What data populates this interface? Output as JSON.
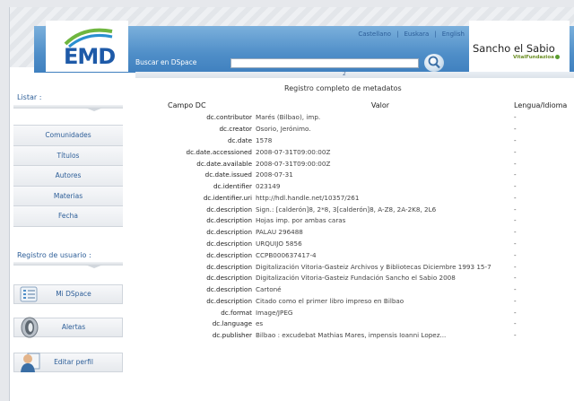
{
  "header": {
    "logo_text": "EMD",
    "languages": [
      "Castellano",
      "Euskara",
      "English"
    ],
    "language_separator": "|",
    "search_label": "Buscar en DSpace",
    "search_value": "",
    "handle_number": "2",
    "sancho_title": "Sancho el Sabio",
    "sancho_subtitle": "VitalFundazioa"
  },
  "sidebar": {
    "browse_heading": "Listar :",
    "browse_items": [
      "Comunidades",
      "Títulos",
      "Autores",
      "Materias",
      "Fecha"
    ],
    "user_heading": "Registro de usuario :",
    "user_items": [
      {
        "label": "Mi DSpace",
        "icon": "list-icon"
      },
      {
        "label": "Alertas",
        "icon": "bell-icon"
      },
      {
        "label": "Editar perfil",
        "icon": "user-profile-icon"
      }
    ]
  },
  "main": {
    "title": "Registro completo de metadatos",
    "columns": [
      "Campo DC",
      "Valor",
      "Lengua/Idioma"
    ],
    "rows": [
      {
        "field": "dc.contributor",
        "value": "Marés (Bilbao), imp.",
        "lang": "-"
      },
      {
        "field": "dc.creator",
        "value": "Osorio, Jerónimo.",
        "lang": "-"
      },
      {
        "field": "dc.date",
        "value": "1578",
        "lang": "-"
      },
      {
        "field": "dc.date.accessioned",
        "value": "2008-07-31T09:00:00Z",
        "lang": "-"
      },
      {
        "field": "dc.date.available",
        "value": "2008-07-31T09:00:00Z",
        "lang": "-"
      },
      {
        "field": "dc.date.issued",
        "value": "2008-07-31",
        "lang": "-"
      },
      {
        "field": "dc.identifier",
        "value": "023149",
        "lang": "-"
      },
      {
        "field": "dc.identifier.uri",
        "value": "http://hdl.handle.net/10357/261",
        "lang": "-"
      },
      {
        "field": "dc.description",
        "value": "Sign.: [calderón]8, 2*8, 3[calderón]8, A-Z8, 2A-2K8, 2L6",
        "lang": "-"
      },
      {
        "field": "dc.description",
        "value": "Hojas imp. por ambas caras",
        "lang": "-"
      },
      {
        "field": "dc.description",
        "value": "PALAU 296488",
        "lang": "-"
      },
      {
        "field": "dc.description",
        "value": "URQUIJO 5856",
        "lang": "-"
      },
      {
        "field": "dc.description",
        "value": "CCPB000637417-4",
        "lang": "-"
      },
      {
        "field": "dc.description",
        "value": "Digitalización Vitoria-Gasteiz Archivos y Bibliotecas Diciembre 1993 15-7",
        "lang": "-"
      },
      {
        "field": "dc.description",
        "value": "Digitalización Vitoria-Gasteiz Fundación Sancho el Sabio 2008",
        "lang": "-"
      },
      {
        "field": "dc.description",
        "value": "Cartoné",
        "lang": "-"
      },
      {
        "field": "dc.description",
        "value": "Citado como el primer libro impreso en Bilbao",
        "lang": "-"
      },
      {
        "field": "dc.format",
        "value": "Image/JPEG",
        "lang": "-"
      },
      {
        "field": "dc.language",
        "value": "es",
        "lang": "-"
      },
      {
        "field": "dc.publisher",
        "value": "Bilbao : excudebat Mathias Mares, impensis Ioanni Lopez...",
        "lang": "-"
      }
    ]
  },
  "colors": {
    "link_blue": "#2d5e98",
    "header_blue": "#4f8ec8"
  }
}
